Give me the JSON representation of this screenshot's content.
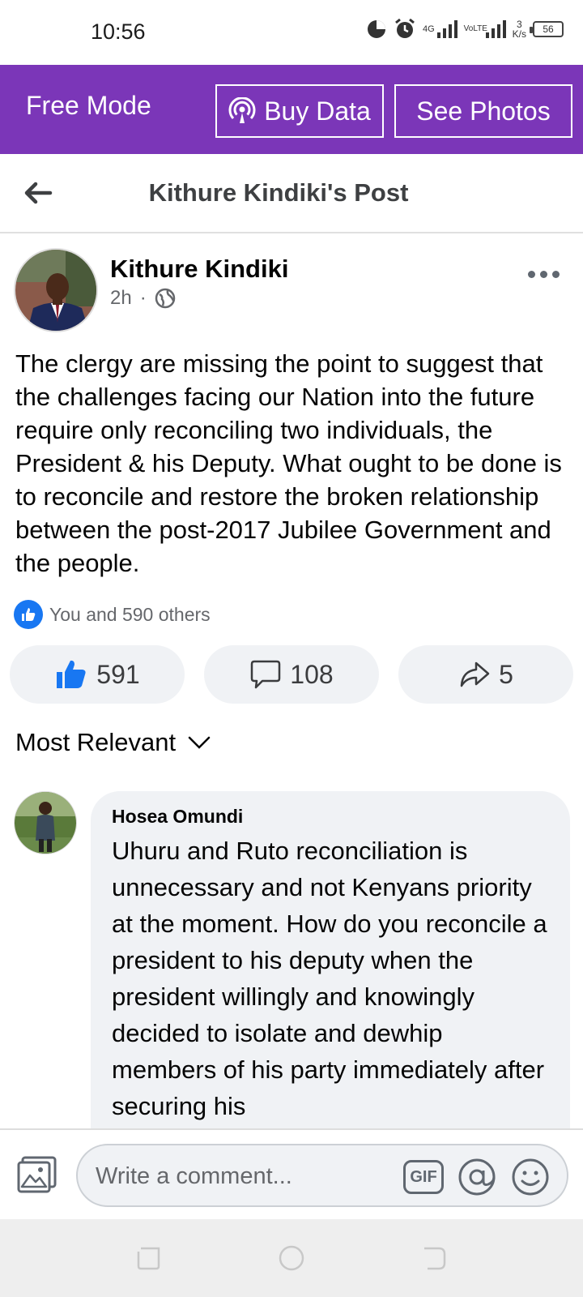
{
  "status_bar": {
    "time": "10:56",
    "network_1": "4G",
    "network_2": "VoLTE",
    "speed_value": "3",
    "speed_unit": "K/s",
    "battery": "56",
    "icons": [
      "data-saver-icon",
      "alarm-icon",
      "signal-icon",
      "signal-icon"
    ]
  },
  "free_bar": {
    "mode_label": "Free Mode",
    "buy_data_label": "Buy Data",
    "see_photos_label": "See Photos",
    "background_color": "#7b36b8"
  },
  "header": {
    "title": "Kithure Kindiki's Post"
  },
  "post": {
    "author": "Kithure Kindiki",
    "time": "2h",
    "separator": "·",
    "audience": "public",
    "text": "The clergy are missing the point to suggest that the challenges facing our Nation into the future require only reconciling two individuals, the President & his Deputy. What ought to be done is to reconcile and restore the broken relationship between the  post-2017 Jubilee Government and the people.",
    "reactions_summary": "You and 590 others",
    "like_count": "591",
    "comment_count": "108",
    "share_count": "5"
  },
  "comments": {
    "sort_label": "Most Relevant",
    "items": [
      {
        "author": "Hosea Omundi",
        "text": "Uhuru and Ruto reconciliation is unnecessary and not Kenyans priority at the moment. How do you reconcile a president to his deputy when the president willingly and knowingly decided to isolate and dewhip members of his party immediately after securing his"
      }
    ]
  },
  "composer": {
    "placeholder": "Write a comment...",
    "gif_label": "GIF"
  },
  "colors": {
    "accent": "#1877f2",
    "purple": "#7b36b8",
    "pill_bg": "#f0f2f5"
  }
}
